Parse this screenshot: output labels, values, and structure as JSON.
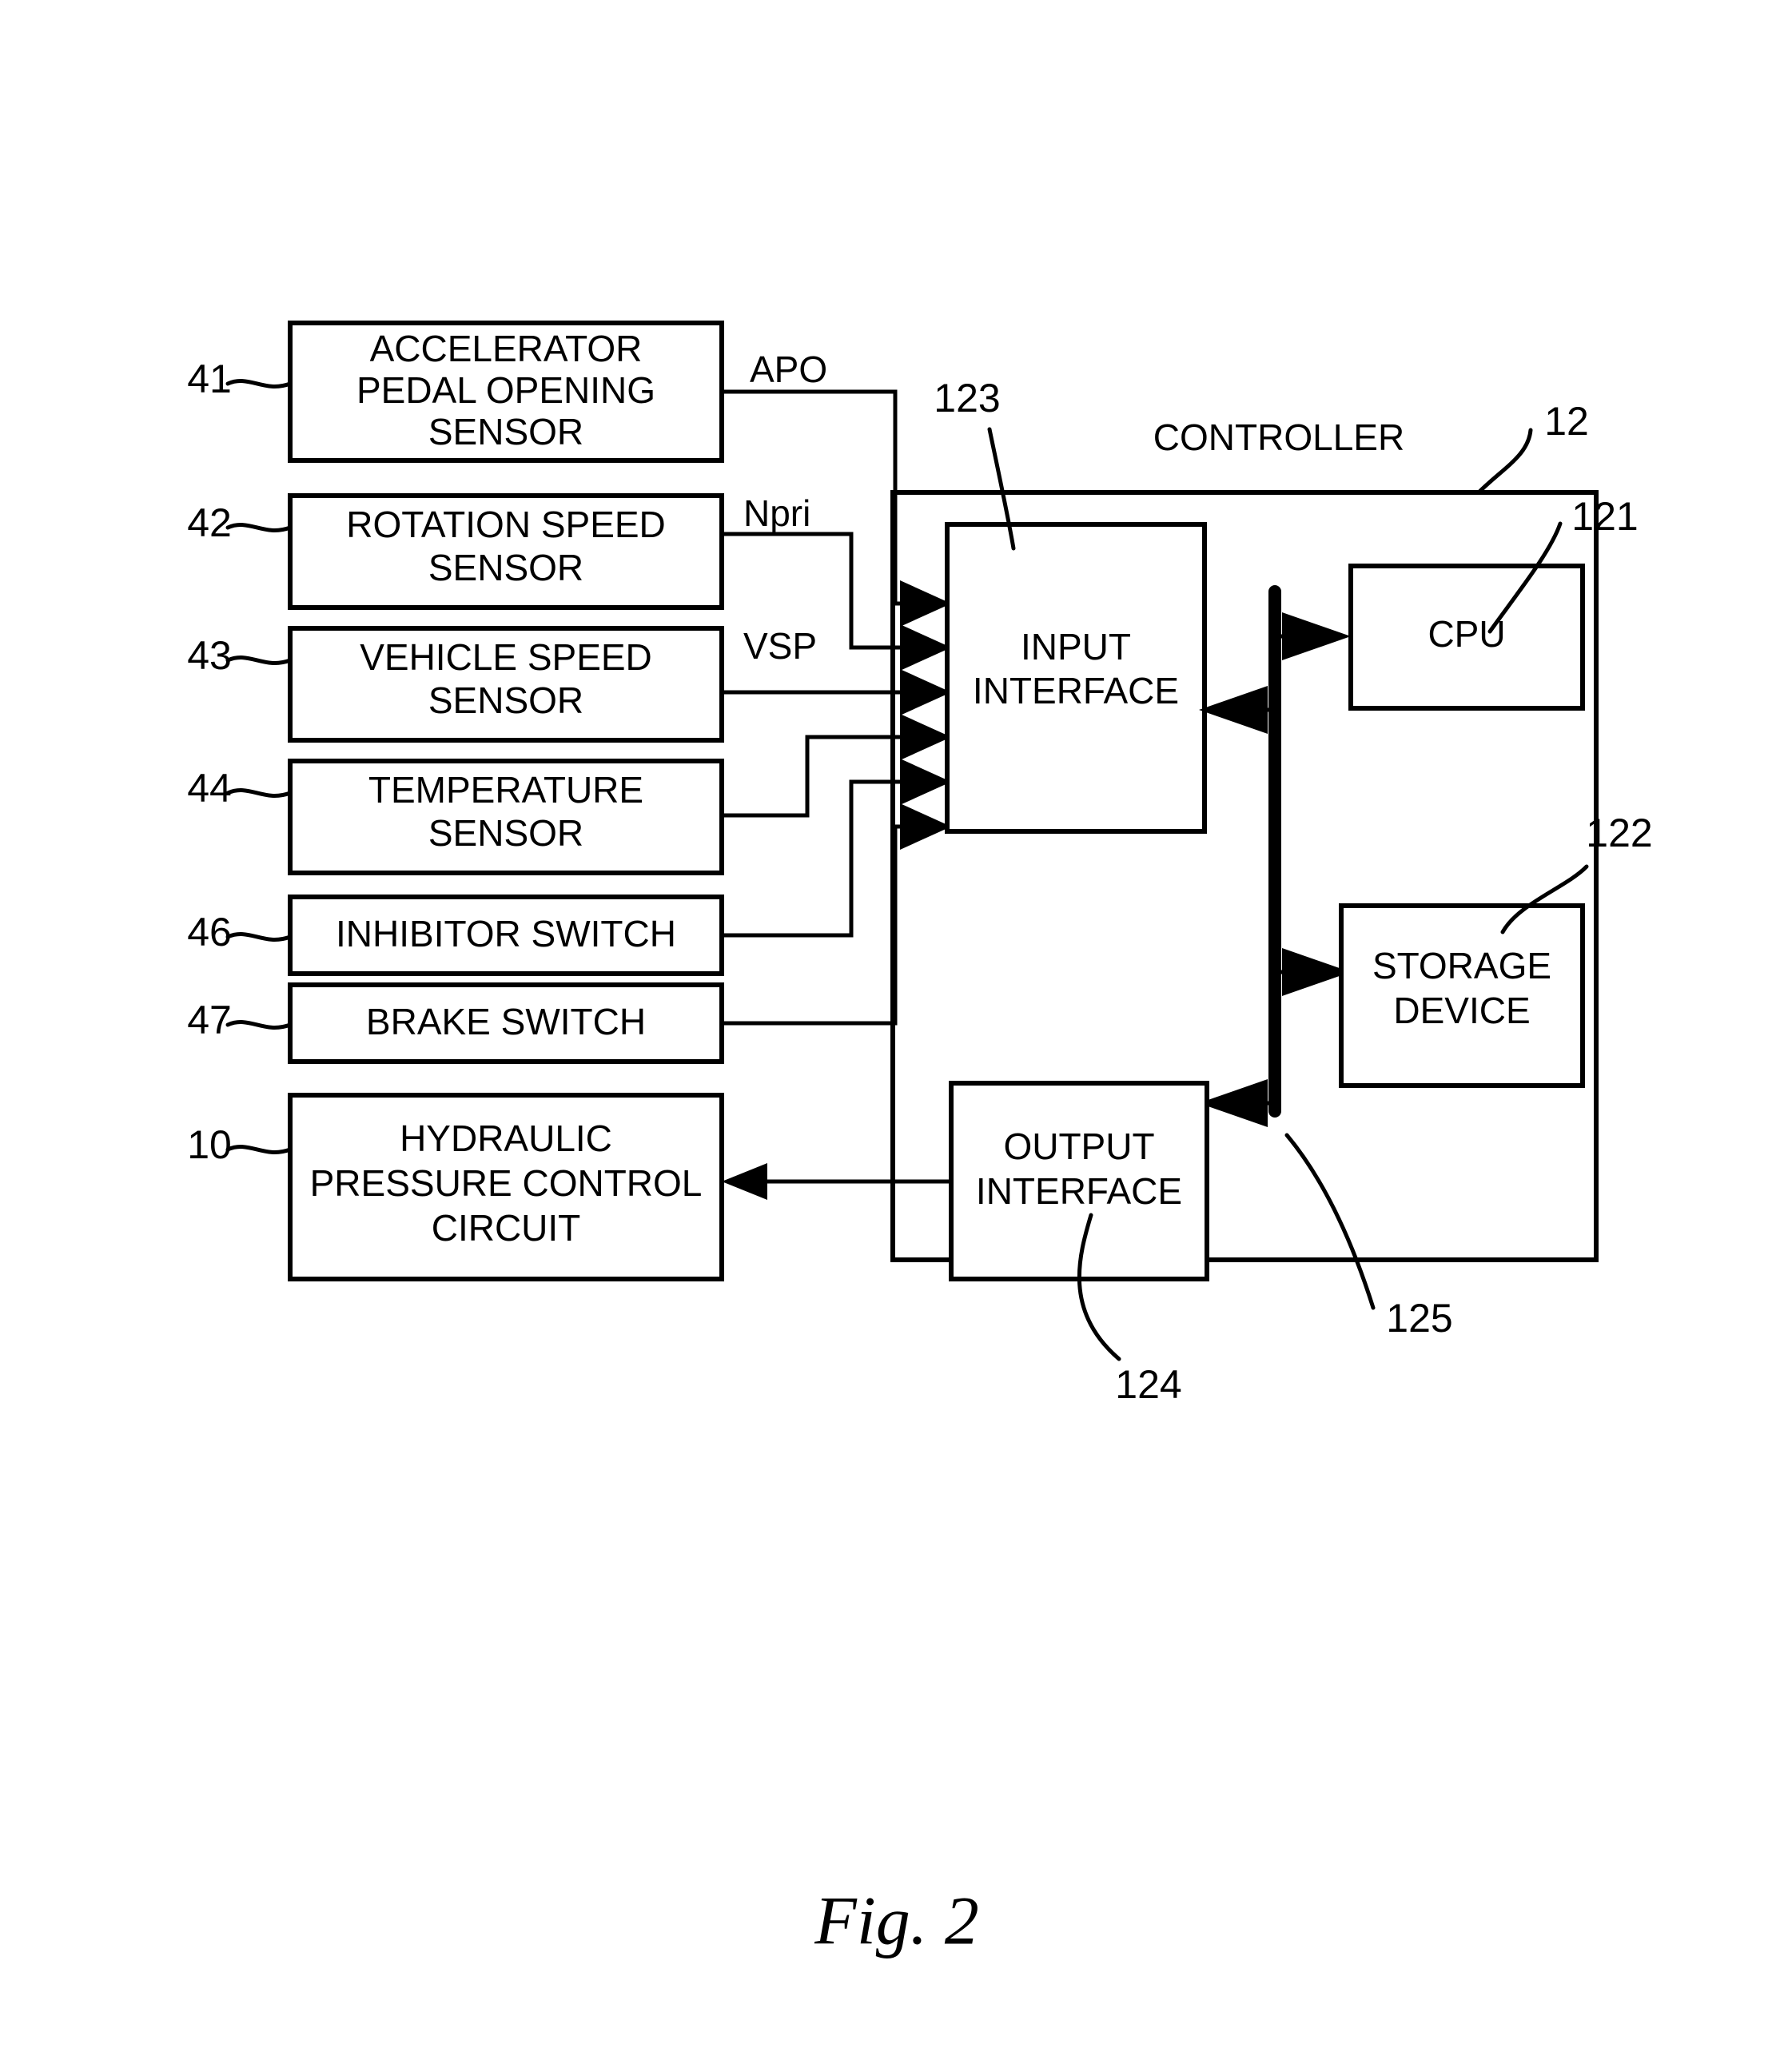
{
  "figure": {
    "caption": "Fig. 2",
    "controller_title": "CONTROLLER"
  },
  "left_blocks": [
    {
      "ref": "41",
      "label_lines": [
        "ACCELERATOR",
        "PEDAL OPENING",
        "SENSOR"
      ],
      "signal": "APO"
    },
    {
      "ref": "42",
      "label_lines": [
        "ROTATION SPEED",
        "SENSOR"
      ],
      "signal": "Npri"
    },
    {
      "ref": "43",
      "label_lines": [
        "VEHICLE SPEED",
        "SENSOR"
      ],
      "signal": "VSP"
    },
    {
      "ref": "44",
      "label_lines": [
        "TEMPERATURE",
        "SENSOR"
      ],
      "signal": ""
    },
    {
      "ref": "46",
      "label_lines": [
        "INHIBITOR SWITCH"
      ],
      "signal": ""
    },
    {
      "ref": "47",
      "label_lines": [
        "BRAKE SWITCH"
      ],
      "signal": ""
    },
    {
      "ref": "10",
      "label_lines": [
        "HYDRAULIC",
        "PRESSURE CONTROL",
        "CIRCUIT"
      ],
      "signal": ""
    }
  ],
  "controller": {
    "ref": "12",
    "title": "CONTROLLER",
    "blocks": [
      {
        "ref": "123",
        "label_lines": [
          "INPUT",
          "INTERFACE"
        ]
      },
      {
        "ref": "121",
        "label_lines": [
          "CPU"
        ]
      },
      {
        "ref": "122",
        "label_lines": [
          "STORAGE",
          "DEVICE"
        ]
      },
      {
        "ref": "124",
        "label_lines": [
          "OUTPUT",
          "INTERFACE"
        ]
      }
    ],
    "bus_ref": "125"
  },
  "colors": {
    "line": "#000000",
    "background": "#ffffff"
  }
}
